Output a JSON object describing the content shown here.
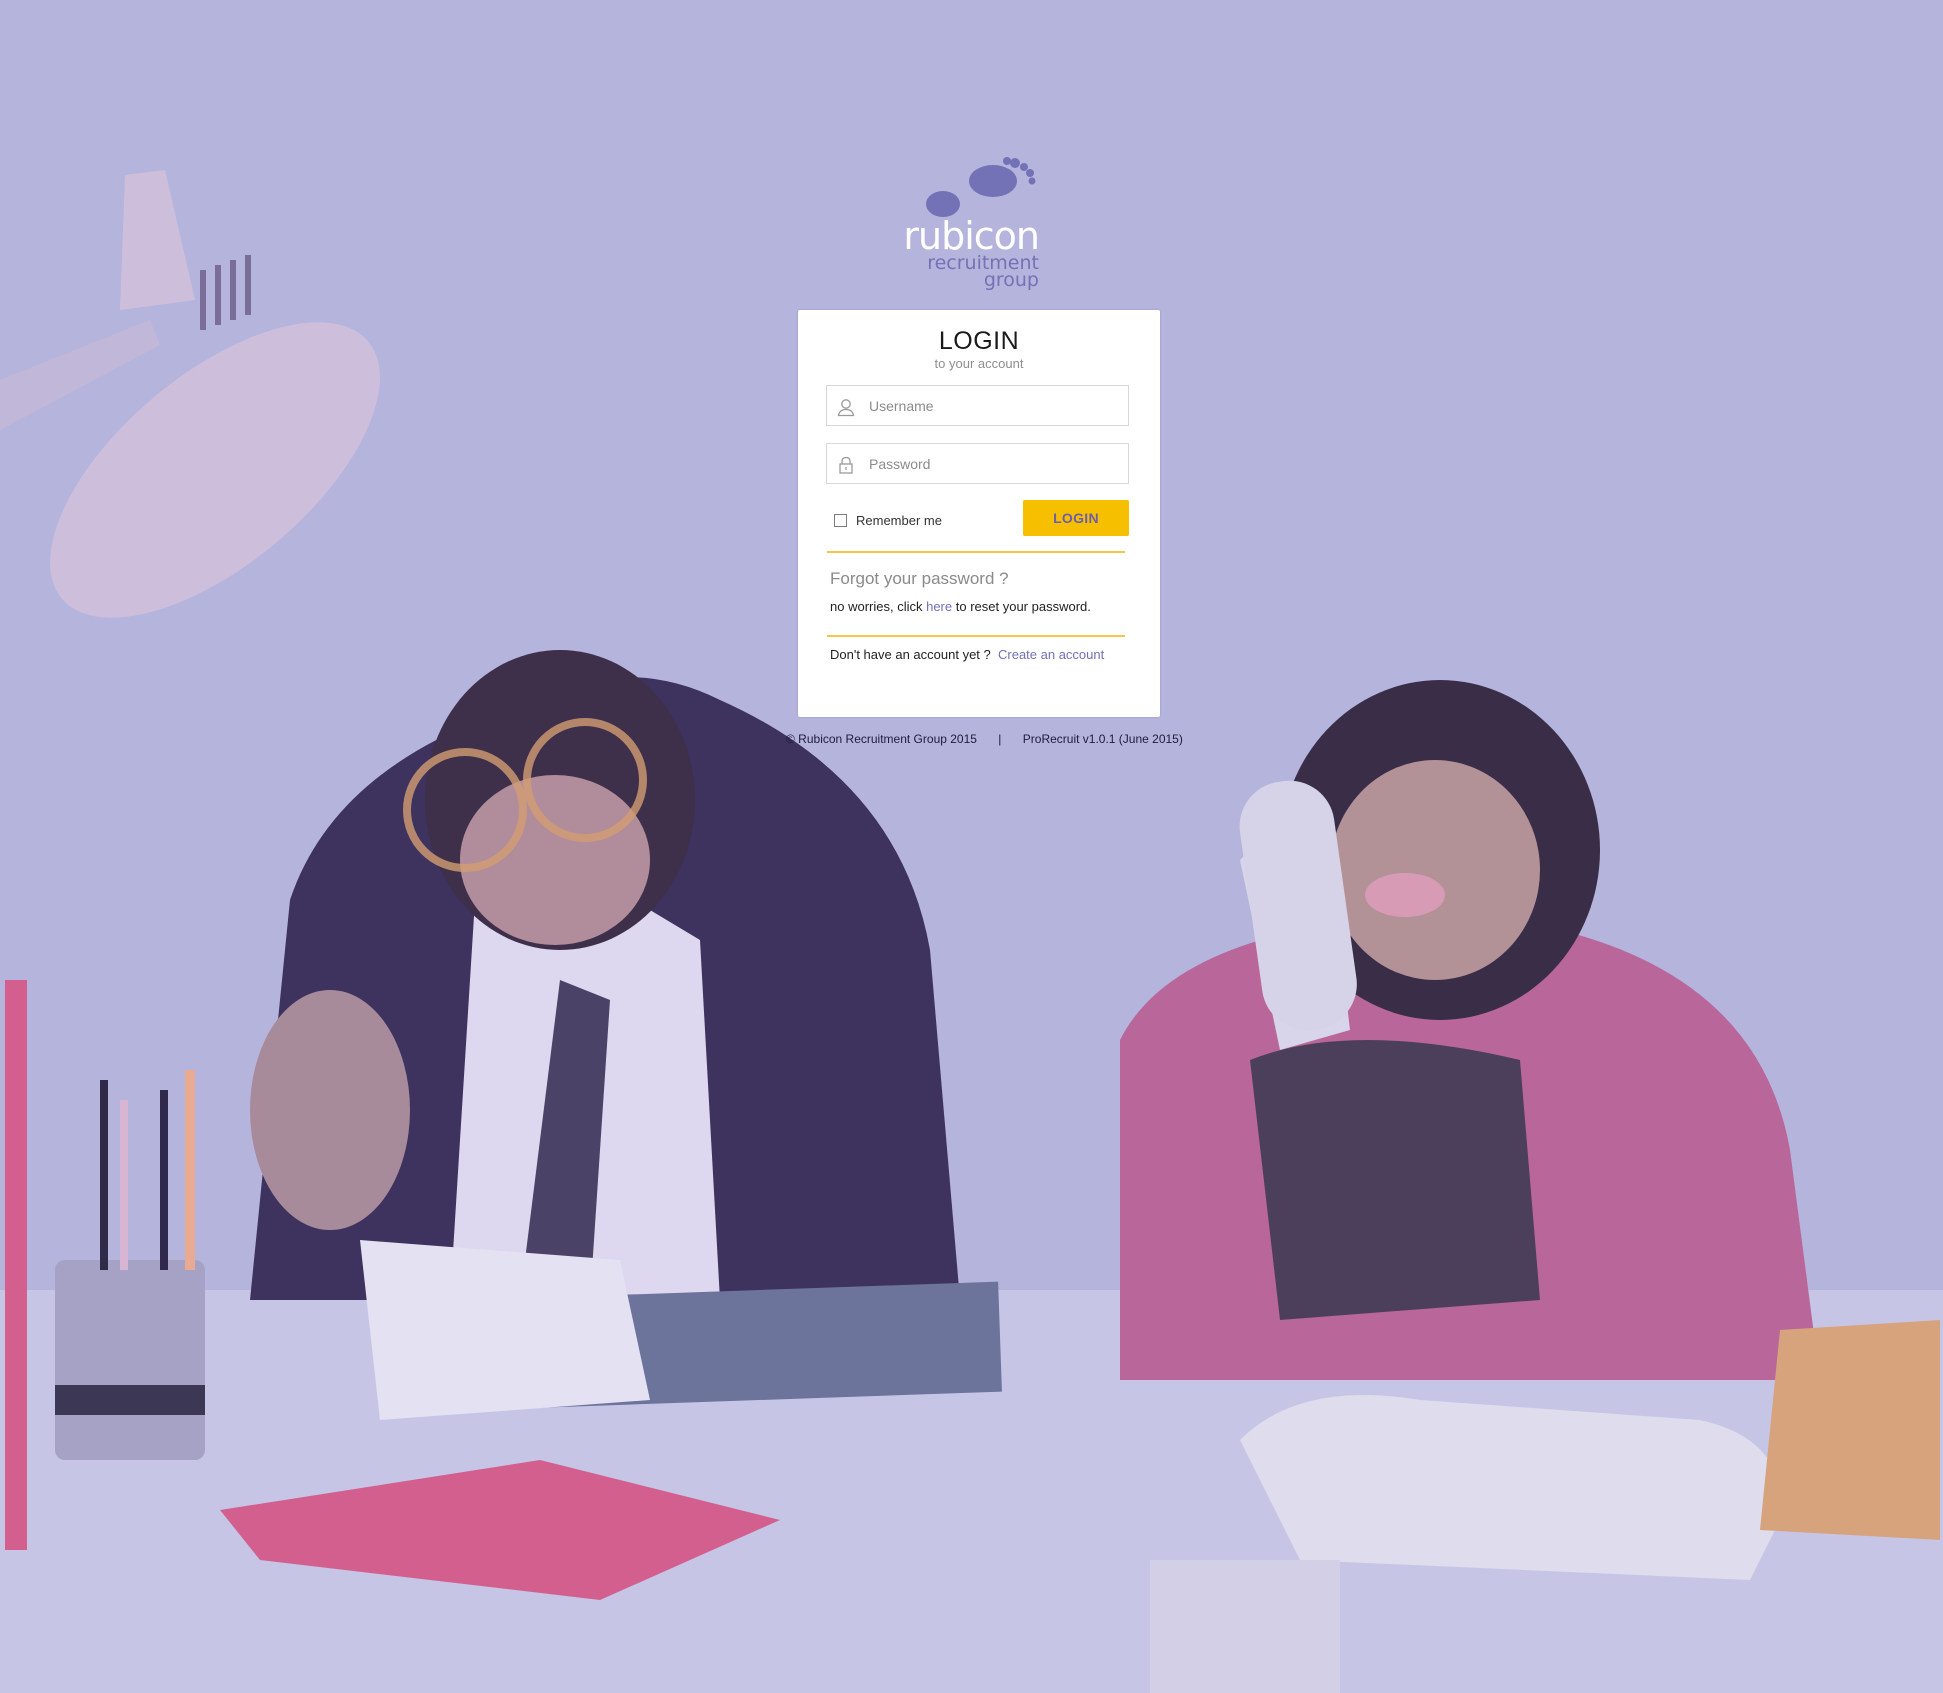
{
  "logo": {
    "brand": "rubicon",
    "line2": "recruitment",
    "line3": "group"
  },
  "login_card": {
    "title": "LOGIN",
    "subtitle": "to your account",
    "username_placeholder": "Username",
    "password_placeholder": "Password",
    "remember_label": "Remember me",
    "login_button": "LOGIN",
    "forgot_title": "Forgot your password ?",
    "forgot_prefix": "no worries, click",
    "forgot_link": "here",
    "forgot_suffix": "to reset your password.",
    "signup_prefix": "Don't have an account yet ?",
    "signup_link": "Create an account"
  },
  "footer": {
    "copyright": "© Rubicon Recruitment Group 2015",
    "separator": "|",
    "version": "ProRecruit v1.0.1 (June 2015)"
  },
  "colors": {
    "background_tint": "#b5b4dc",
    "accent_yellow": "#f6c000",
    "link_purple": "#7270b8",
    "logo_purple": "#7472b6"
  },
  "icons": {
    "logo": "footprints-icon",
    "username": "user-icon",
    "password": "lock-icon"
  }
}
